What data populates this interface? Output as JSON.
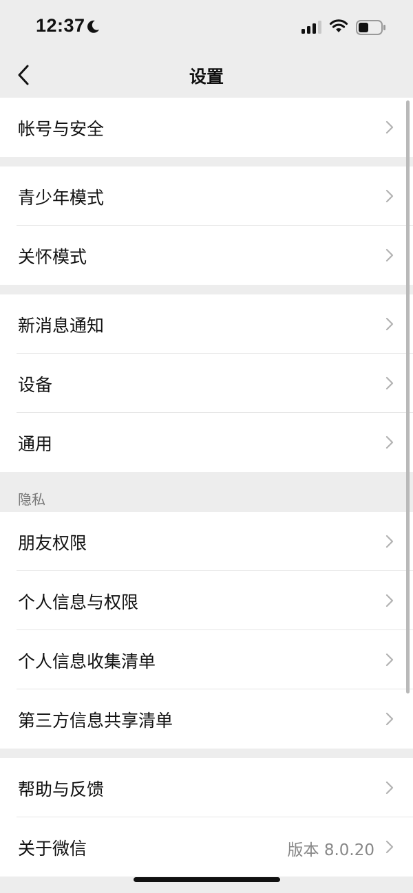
{
  "status": {
    "time": "12:37",
    "moon_icon": "moon-icon",
    "signal_icon": "cellular-signal-icon",
    "wifi_icon": "wifi-icon",
    "battery_icon": "battery-icon"
  },
  "nav": {
    "title": "设置",
    "back_icon": "chevron-left-icon"
  },
  "groups": {
    "account": {
      "security": "帐号与安全"
    },
    "modes": {
      "youth": "青少年模式",
      "care": "关怀模式"
    },
    "general": {
      "notifications": "新消息通知",
      "devices": "设备",
      "general": "通用"
    },
    "privacy": {
      "header": "隐私",
      "friend_permissions": "朋友权限",
      "personal_info_permissions": "个人信息与权限",
      "personal_info_list": "个人信息收集清单",
      "third_party_list": "第三方信息共享清单"
    },
    "about": {
      "help": "帮助与反馈",
      "about_wechat": "关于微信",
      "version": "版本 8.0.20"
    }
  },
  "colors": {
    "background": "#ededed",
    "cell": "#ffffff",
    "text": "#111111",
    "secondary_text": "#888888"
  }
}
